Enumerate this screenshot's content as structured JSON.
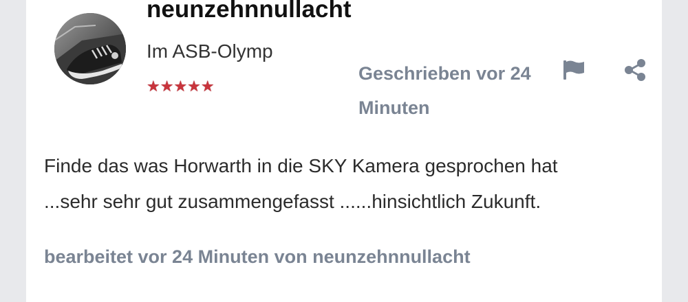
{
  "post": {
    "username": "neunzehnnullacht",
    "rank": "Im ASB-Olymp",
    "stars": "★★★★★",
    "written_label": "Geschrieben vor 24 Minuten",
    "body_lines": [
      "Finde das was Horwarth in die SKY Kamera gesprochen hat",
      "...sehr sehr gut zusammengefasst ......hinsichtlich Zukunft."
    ],
    "edited_label": "bearbeitet vor 24 Minuten von neunzehnnullacht"
  },
  "icons": {
    "avatar": "avatar-photo-sneaker",
    "report": "flag-icon",
    "share": "share-icon"
  },
  "colors": {
    "page_bg": "#e8e9ec",
    "card_bg": "#ffffff",
    "muted_text": "#7a8493",
    "icon": "#7a8493",
    "stars": "#c8343c"
  }
}
